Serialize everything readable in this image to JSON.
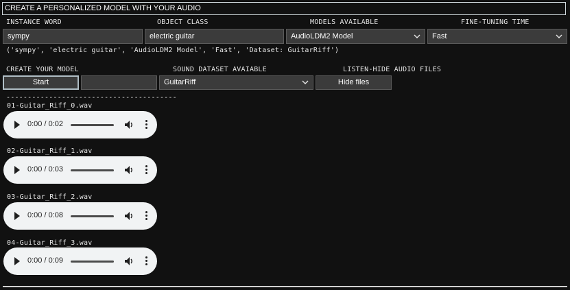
{
  "title": "CREATE A PERSONALIZED MODEL WITH YOUR AUDIO",
  "labels": {
    "instance_word": "INSTANCE WORD",
    "object_class": "OBJECT CLASS",
    "models_available": "MODELS AVAILABLE",
    "fine_tuning_time": "FINE-TUNING TIME",
    "create_model": "CREATE YOUR MODEL",
    "sound_dataset": "SOUND DATASET AVAIABLE",
    "listen_hide": "LISTEN-HIDE AUDIO FILES"
  },
  "fields": {
    "instance_word": "sympy",
    "object_class": "electric guitar",
    "model": "AudioLDM2 Model",
    "fine_tuning": "Fast",
    "dataset": "GuitarRiff"
  },
  "summary": "('sympy', 'electric guitar', 'AudioLDM2 Model', 'Fast', 'Dataset: GuitarRiff')",
  "buttons": {
    "start": "Start",
    "hide_files": "Hide files"
  },
  "separator": "----------------------------------------",
  "icons": {
    "chevron": "chevron-down-icon",
    "play": "play-icon",
    "volume": "volume-icon",
    "more": "more-vert-icon"
  },
  "audio_files": [
    {
      "name": "01-Guitar_Riff_0.wav",
      "time": "0:00 / 0:02"
    },
    {
      "name": "02-Guitar_Riff_1.wav",
      "time": "0:00 / 0:03"
    },
    {
      "name": "03-Guitar_Riff_2.wav",
      "time": "0:00 / 0:08"
    },
    {
      "name": "04-Guitar_Riff_3.wav",
      "time": "0:00 / 0:09"
    }
  ]
}
